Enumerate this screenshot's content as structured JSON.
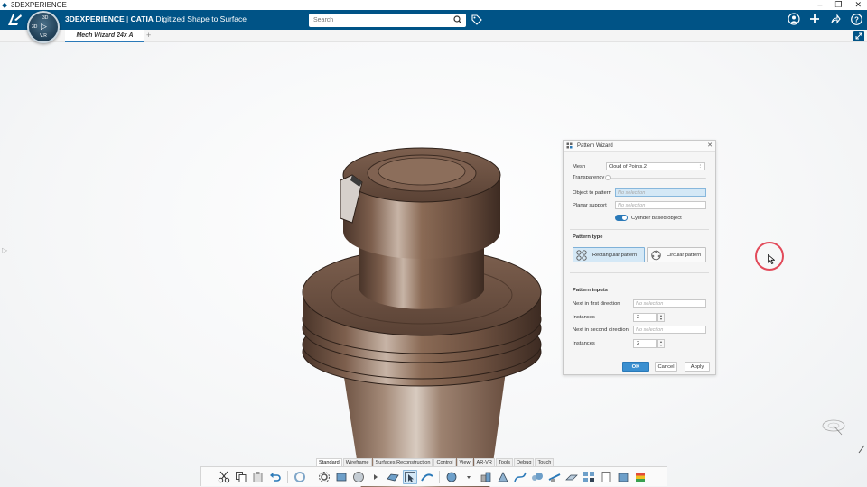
{
  "os_window": {
    "title": "3DEXPERIENCE",
    "controls": [
      "–",
      "❐",
      "✕"
    ]
  },
  "top_bar": {
    "brand_bold": "3DEXPERIENCE",
    "brand_sep": " | ",
    "brand_app": "CATIA",
    "brand_role": " Digitized Shape to Surface",
    "search_placeholder": "Search"
  },
  "compass": {
    "vr_label": "V.R",
    "top_label": "3D",
    "left_label": "3D"
  },
  "tabs": [
    {
      "label": "Mech Wizard 24x A"
    }
  ],
  "tab_add": "+",
  "pattern_wizard": {
    "title": "Pattern Wizard",
    "close": "✕",
    "mesh_label": "Mesh",
    "mesh_value": "Cloud of Points.2",
    "mesh_menu": "⋮",
    "transparency_label": "Transparency",
    "transparency_value": 0,
    "object_label": "Object to pattern",
    "object_placeholder": "No selection",
    "planar_label": "Planar support",
    "planar_placeholder": "No selection",
    "cylinder_toggle_label": "Cylinder based object",
    "cylinder_toggle_on": true,
    "pattern_type_title": "Pattern type",
    "rectangular_label": "Rectangular pattern",
    "circular_label": "Circular pattern",
    "pattern_inputs_title": "Pattern inputs",
    "next_first_label": "Next in first direction",
    "next_first_placeholder": "No selection",
    "instances1_label": "Instances",
    "instances1_value": "2",
    "next_second_label": "Next in second direction",
    "next_second_placeholder": "No selection",
    "instances2_label": "Instances",
    "instances2_value": "2",
    "ok": "OK",
    "cancel": "Cancel",
    "apply": "Apply"
  },
  "section_tabs": [
    "Standard",
    "Wireframe",
    "Surfaces Reconstruction",
    "Control",
    "View",
    "AR-VR",
    "Tools",
    "Debug",
    "Touch"
  ],
  "colors": {
    "top_bar": "#005386",
    "accent": "#2a79b8",
    "selected": "#d4e8f6",
    "model_bronze": "#8a6a55",
    "click_ring": "#e24a5a"
  }
}
